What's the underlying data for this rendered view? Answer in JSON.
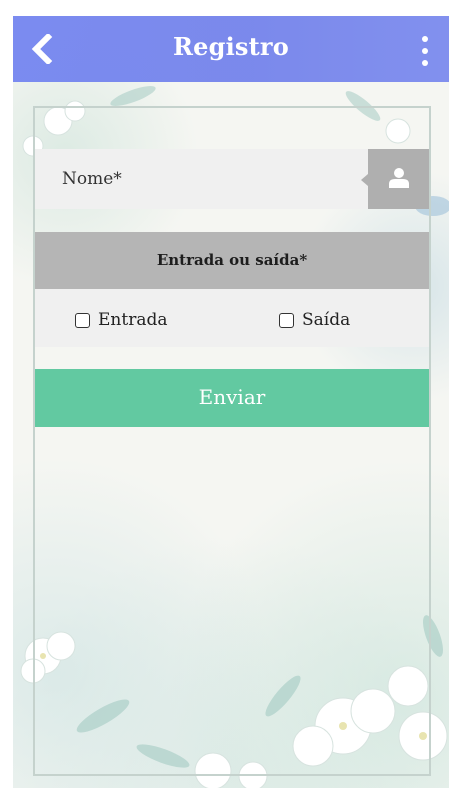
{
  "app_bar": {
    "title": "Registro",
    "back_icon": "chevron-left-icon",
    "menu_icon": "more-vertical-icon",
    "color": "#7487f0"
  },
  "form": {
    "name_label": "Nome*",
    "name_icon": "user-icon",
    "type_header": "Entrada ou saída*",
    "options": [
      {
        "label": "Entrada",
        "checked": false
      },
      {
        "label": "Saída",
        "checked": false
      }
    ],
    "submit_label": "Enviar",
    "submit_color": "#62c9a1"
  }
}
